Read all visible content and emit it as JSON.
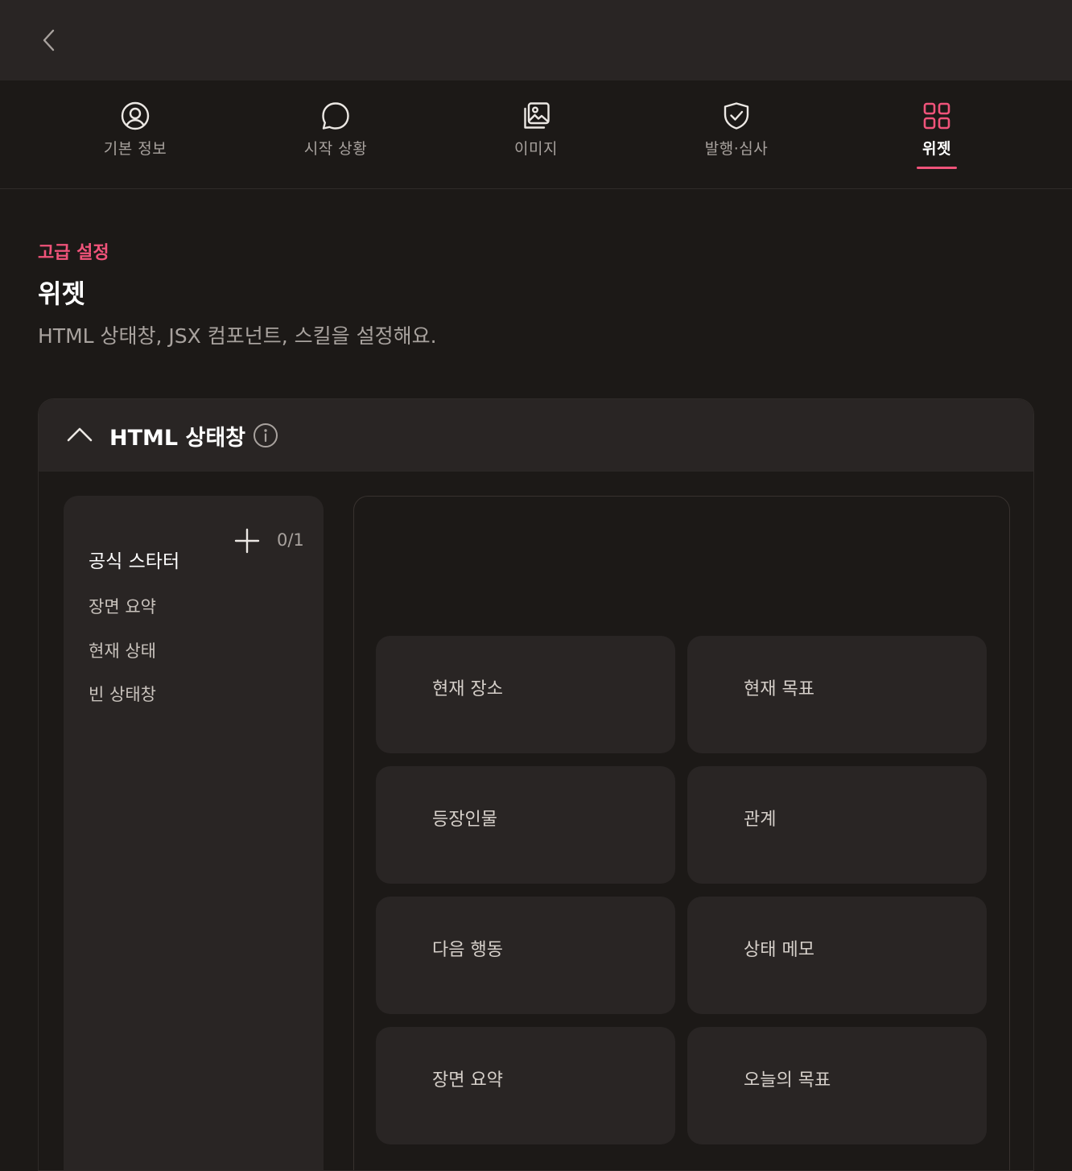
{
  "topbar": {
    "back_icon": "chevron-left-icon"
  },
  "tabs": [
    {
      "label": "기본 정보",
      "icon": "user-circle-icon",
      "active": false
    },
    {
      "label": "시작 상황",
      "icon": "chat-bubble-icon",
      "active": false
    },
    {
      "label": "이미지",
      "icon": "images-icon",
      "active": false
    },
    {
      "label": "발행·심사",
      "icon": "shield-check-icon",
      "active": false
    },
    {
      "label": "위젯",
      "icon": "grid-icon",
      "active": true
    }
  ],
  "colors": {
    "accent": "#f0537a",
    "background": "#1c1917",
    "surface": "#292524"
  },
  "header": {
    "eyebrow": "고급 설정",
    "title": "위젯",
    "description": "HTML 상태창, JSX 컴포넌트, 스킬을 설정해요."
  },
  "panel": {
    "title": "HTML 상태창",
    "expanded": true,
    "list": {
      "count": "0/1",
      "heading": "공식 스타터",
      "items": [
        "장면 요약",
        "현재 상태",
        "빈 상태창"
      ]
    },
    "preview_cells": [
      "현재 장소",
      "현재 목표",
      "등장인물",
      "관계",
      "다음 행동",
      "상태 메모",
      "장면 요약",
      "오늘의 목표"
    ]
  }
}
